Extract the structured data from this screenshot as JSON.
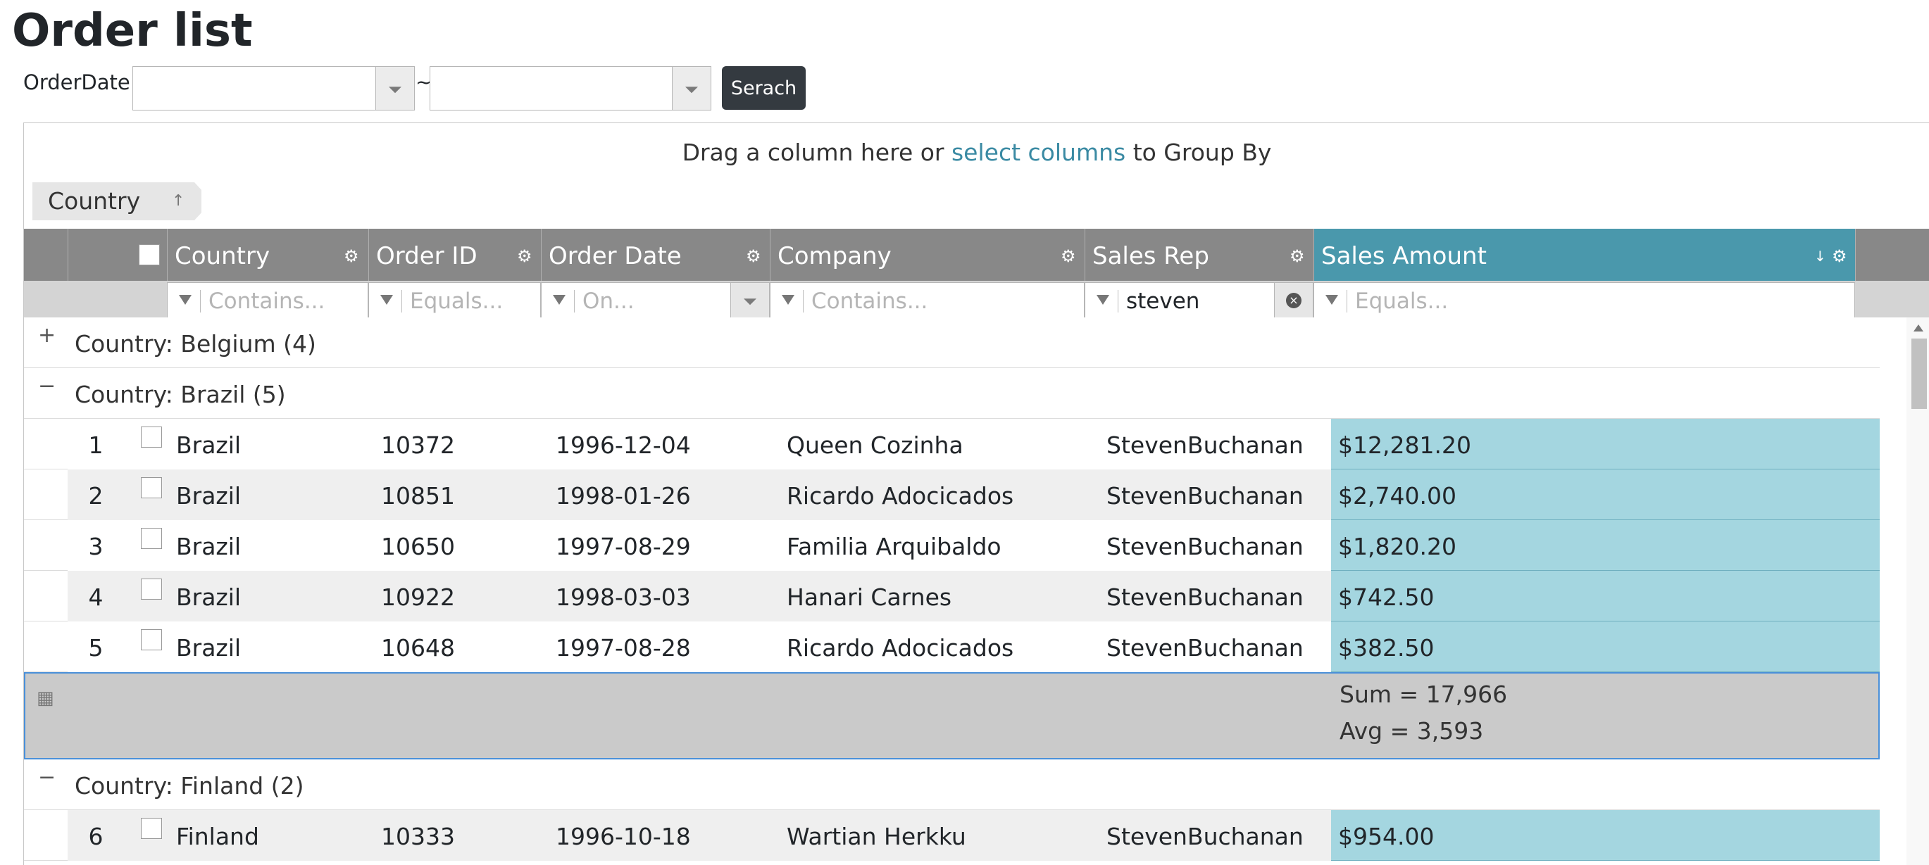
{
  "page": {
    "title": "Order list"
  },
  "filter_bar": {
    "order_date_label": "OrderDate:",
    "from_value": "",
    "separator": "~",
    "to_value": "",
    "search_label": "Serach"
  },
  "group_panel": {
    "hint_before": "Drag a column here or ",
    "hint_link": "select columns",
    "hint_after": " to Group By",
    "chip_label": "Country",
    "chip_arrow": "↑"
  },
  "columns": [
    {
      "label": "Country",
      "filter_placeholder": "Contains...",
      "filter_value": ""
    },
    {
      "label": "Order ID",
      "filter_placeholder": "Equals...",
      "filter_value": ""
    },
    {
      "label": "Order Date",
      "filter_placeholder": "On...",
      "filter_value": ""
    },
    {
      "label": "Company",
      "filter_placeholder": "Contains...",
      "filter_value": ""
    },
    {
      "label": "Sales Rep",
      "filter_placeholder": "",
      "filter_value": "steven"
    },
    {
      "label": "Sales Amount",
      "filter_placeholder": "Equals...",
      "filter_value": "",
      "sorted": true,
      "sort_icon": "↓"
    }
  ],
  "icons": {
    "gear": "⚙",
    "collapse": "−",
    "expand": "+",
    "summary": "▦",
    "clear": "×"
  },
  "groups": [
    {
      "label": "Country: Belgium (4)",
      "toggle": "+"
    },
    {
      "label": "Country: Brazil (5)",
      "toggle": "−"
    },
    {
      "label": "Country: Finland (2)",
      "toggle": "−"
    }
  ],
  "rows": [
    {
      "num": "1",
      "country": "Brazil",
      "order_id": "10372",
      "order_date": "1996-12-04",
      "company": "Queen Cozinha",
      "sales_rep": "StevenBuchanan",
      "amount": "$12,281.20"
    },
    {
      "num": "2",
      "country": "Brazil",
      "order_id": "10851",
      "order_date": "1998-01-26",
      "company": "Ricardo Adocicados",
      "sales_rep": "StevenBuchanan",
      "amount": "$2,740.00"
    },
    {
      "num": "3",
      "country": "Brazil",
      "order_id": "10650",
      "order_date": "1997-08-29",
      "company": "Familia Arquibaldo",
      "sales_rep": "StevenBuchanan",
      "amount": "$1,820.20"
    },
    {
      "num": "4",
      "country": "Brazil",
      "order_id": "10922",
      "order_date": "1998-03-03",
      "company": "Hanari Carnes",
      "sales_rep": "StevenBuchanan",
      "amount": "$742.50"
    },
    {
      "num": "5",
      "country": "Brazil",
      "order_id": "10648",
      "order_date": "1997-08-28",
      "company": "Ricardo Adocicados",
      "sales_rep": "StevenBuchanan",
      "amount": "$382.50"
    },
    {
      "num": "6",
      "country": "Finland",
      "order_id": "10333",
      "order_date": "1996-10-18",
      "company": "Wartian Herkku",
      "sales_rep": "StevenBuchanan",
      "amount": "$954.00"
    }
  ],
  "summary": {
    "sum": "Sum = 17,966",
    "avg": "Avg = 3,593"
  },
  "colors": {
    "header_bg": "#888888",
    "sorted_header": "#4a98ac",
    "amount_cell": "#a4d6e0",
    "summary_bg": "#cacaca",
    "search_button": "#343a40",
    "link": "#3a8aa3"
  }
}
